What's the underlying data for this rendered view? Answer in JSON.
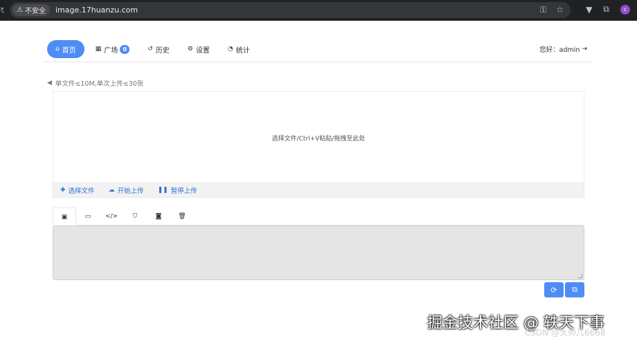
{
  "browser": {
    "security_label": "不安全",
    "url": "image.17huanzu.com",
    "profile_initial": "c",
    "icons": [
      "key-icon",
      "star-icon",
      "extensions-icon",
      "media-icon"
    ]
  },
  "nav": {
    "items": [
      {
        "label": "首页",
        "icon": "home-icon"
      },
      {
        "label": "广场",
        "icon": "grid-icon",
        "badge": "0"
      },
      {
        "label": "历史",
        "icon": "history-icon"
      },
      {
        "label": "设置",
        "icon": "cogs-icon"
      },
      {
        "label": "统计",
        "icon": "pie-chart-icon"
      }
    ],
    "greeting": "您好：admin"
  },
  "notice": "单文件≤10M,单次上传≤30张",
  "dropzone": {
    "text": "选择文件/Ctrl+V粘贴/拖拽至此处"
  },
  "upload_bar": {
    "select": "选择文件",
    "start": "开始上传",
    "pause": "暂停上传"
  },
  "tabs": [
    "image-icon",
    "comment-icon",
    "code-icon",
    "html5-icon",
    "camera-icon",
    "trash-icon"
  ],
  "watermark": {
    "main": "掘金技术社区 @ 轶天下事",
    "sub": "CSDN @大帅儿6668"
  },
  "colors": {
    "accent": "#4e8df5",
    "link": "#2f6fd6",
    "chrome": "#202124"
  }
}
